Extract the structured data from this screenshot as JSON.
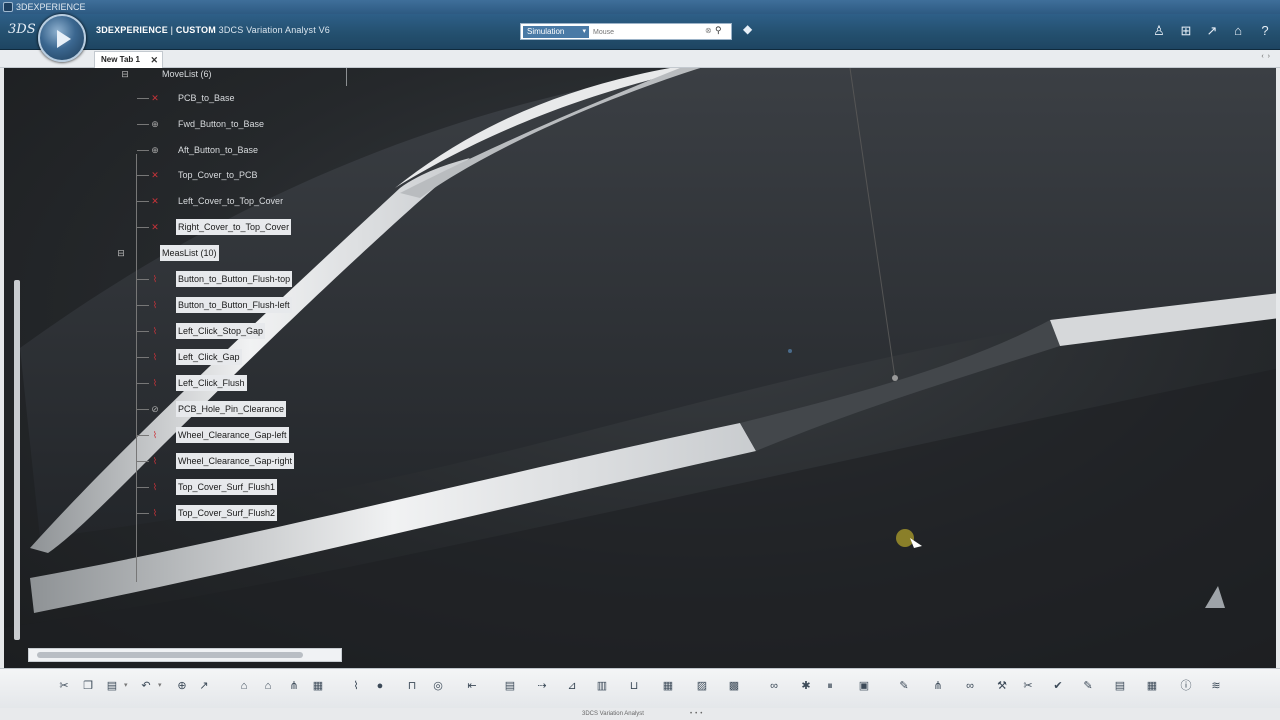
{
  "window": {
    "title": "3DEXPERIENCE"
  },
  "topbar": {
    "logo": "3DS",
    "brand_bold": "3DEXPERIENCE",
    "separator": "|",
    "brand_role": "CUSTOM",
    "brand_app": "3DCS Variation Analyst V6",
    "search": {
      "scope": "Simulation",
      "placeholder": "Mouse"
    },
    "icons": [
      "person-icon",
      "plus-icon",
      "share-icon",
      "home-icon",
      "help-icon"
    ]
  },
  "tabs": [
    {
      "label": "New Tab 1"
    }
  ],
  "tree": {
    "top_partial": "MoveList (6)",
    "moves": [
      {
        "label": "PCB_to_Base",
        "selected": false
      },
      {
        "label": "Fwd_Button_to_Base",
        "selected": false
      },
      {
        "label": "Aft_Button_to_Base",
        "selected": false
      },
      {
        "label": "Top_Cover_to_PCB",
        "selected": false
      },
      {
        "label": "Left_Cover_to_Top_Cover",
        "selected": false
      },
      {
        "label": "Right_Cover_to_Top_Cover",
        "selected": true
      }
    ],
    "meas_list": {
      "label": "MeasList (10)"
    },
    "measures": [
      {
        "label": "Button_to_Button_Flush-top"
      },
      {
        "label": "Button_to_Button_Flush-left"
      },
      {
        "label": "Left_Click_Stop_Gap"
      },
      {
        "label": "Left_Click_Gap"
      },
      {
        "label": "Left_Click_Flush"
      },
      {
        "label": "PCB_Hole_Pin_Clearance"
      },
      {
        "label": "Wheel_Clearance_Gap-left"
      },
      {
        "label": "Wheel_Clearance_Gap-right"
      },
      {
        "label": "Top_Cover_Surf_Flush1"
      },
      {
        "label": "Top_Cover_Surf_Flush2"
      }
    ]
  },
  "statusbar": {
    "text": "3DCS Variation Analyst"
  }
}
